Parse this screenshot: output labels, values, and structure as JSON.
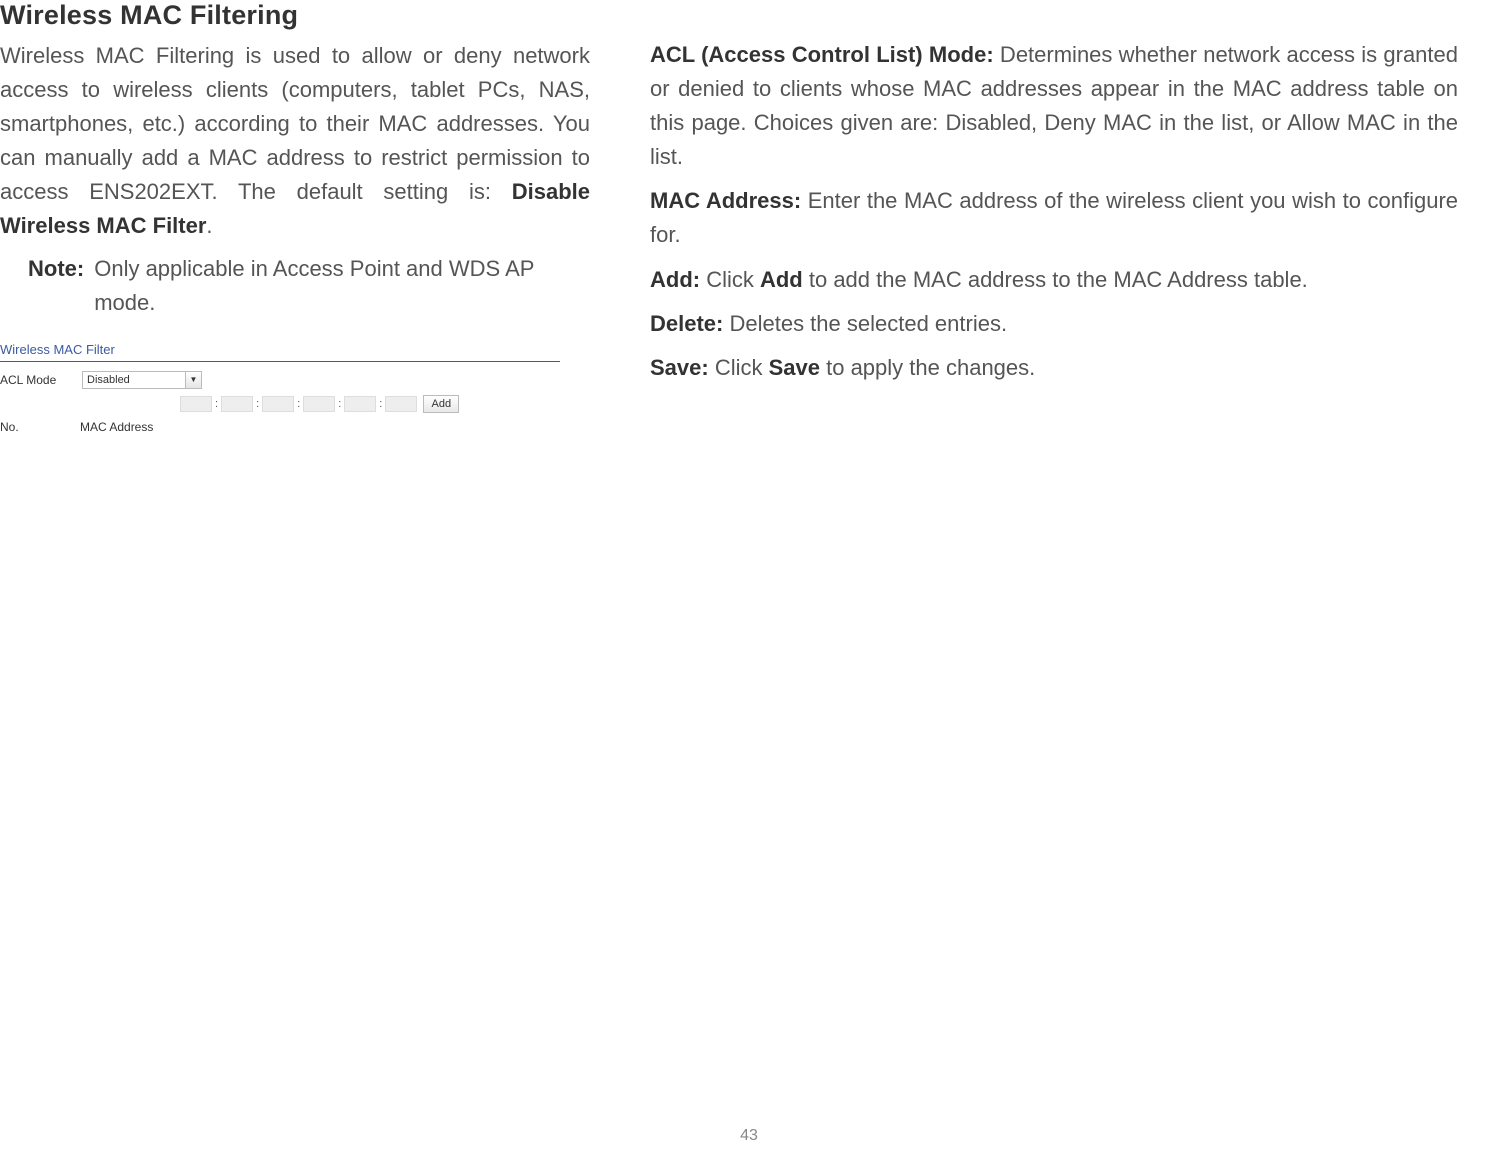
{
  "heading": "Wireless MAC Filtering",
  "intro_part1": "Wireless MAC Filtering is used to allow or deny network access to wireless clients (computers, tablet PCs, NAS, smartphones, etc.) according to their MAC addresses. You can manually add a MAC address to restrict permission to access ENS202EXT. The default setting is: ",
  "intro_bold": "Disable Wireless MAC Filter",
  "intro_end": ".",
  "note_label": "Note:",
  "note_text": "Only applicable in Access Point and WDS AP mode.",
  "screenshot": {
    "title": "Wireless MAC Filter",
    "acl_label": "ACL Mode",
    "acl_value": "Disabled",
    "add_button": "Add",
    "col_no": "No.",
    "col_mac": "MAC Address"
  },
  "defs": {
    "acl": {
      "term": "ACL (Access Control List) Mode:",
      "text": " Determines whether network access is granted or denied to clients whose MAC addresses appear in the MAC address table on this page. Choices given are: Disabled, Deny MAC in the list, or Allow MAC in the list."
    },
    "mac": {
      "term": "MAC Address:",
      "text": " Enter the MAC address of the wireless client you wish to configure for."
    },
    "add": {
      "term": "Add:",
      "pre": " Click ",
      "bold": "Add",
      "post": " to add the MAC address to the MAC Address table."
    },
    "delete": {
      "term": "Delete:",
      "text": " Deletes the selected entries."
    },
    "save": {
      "term": "Save:",
      "pre": " Click ",
      "bold": "Save",
      "post": " to apply the changes."
    }
  },
  "page_number": "43"
}
